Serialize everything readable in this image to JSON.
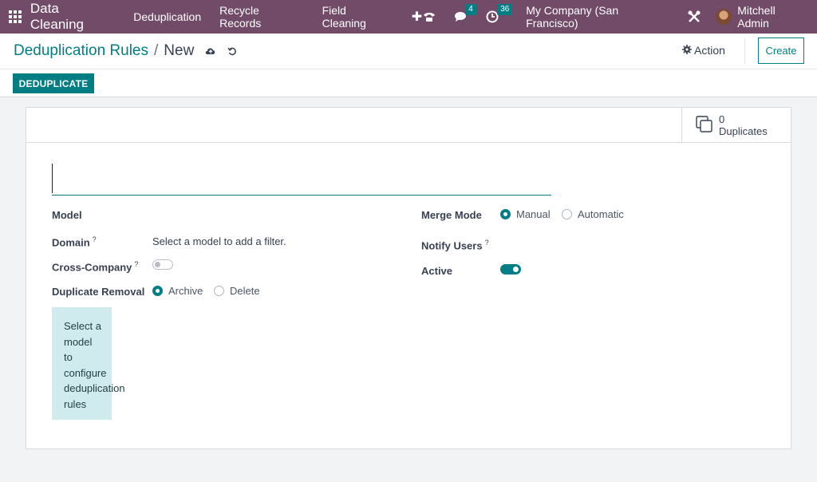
{
  "navbar": {
    "app_name": "Data Cleaning",
    "menu": [
      "Deduplication",
      "Recycle Records",
      "Field Cleaning"
    ],
    "plus": "✚",
    "messages_badge": "4",
    "activities_badge": "36",
    "company": "My Company (San Francisco)",
    "user": "Mitchell Admin"
  },
  "control": {
    "breadcrumb_parent": "Deduplication Rules",
    "separator": "/",
    "breadcrumb_current": "New",
    "action_label": "Action",
    "create_label": "Create"
  },
  "statusbar": {
    "deduplicate_label": "DEDUPLICATE"
  },
  "sheet": {
    "duplicates_count": "0",
    "duplicates_label": "Duplicates",
    "name_value": "",
    "model_label": "Model",
    "domain_label": "Domain",
    "domain_help": "?",
    "domain_placeholder": "Select a model to add a filter.",
    "cross_company_label": "Cross-Company",
    "cross_company_help": "?",
    "cross_company_enabled": false,
    "removal_label": "Duplicate Removal",
    "removal_options": [
      "Archive",
      "Delete"
    ],
    "removal_selected": "Archive",
    "merge_mode_label": "Merge Mode",
    "merge_options": [
      "Manual",
      "Automatic"
    ],
    "merge_selected": "Manual",
    "notify_label": "Notify Users",
    "notify_help": "?",
    "active_label": "Active",
    "active_enabled": true,
    "info_words": [
      "Select a",
      "model",
      "to",
      "configure",
      "deduplication",
      "rules"
    ]
  },
  "colors": {
    "navbar": "#714b67",
    "accent": "#017e84",
    "info_bg": "#d0ebee"
  },
  "icons": [
    "apps-grid-icon",
    "phone-icon",
    "chat-icon",
    "clock-icon",
    "tools-icon",
    "cloud-save-icon",
    "discard-icon",
    "gear-icon",
    "duplicates-icon"
  ]
}
